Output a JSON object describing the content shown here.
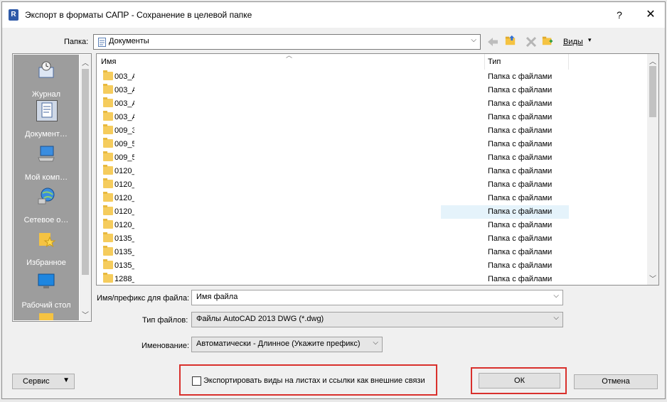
{
  "window": {
    "app_icon_letter": "R",
    "title": "Экспорт в форматы САПР - Сохранение в целевой папке",
    "help_label": "?",
    "close_label": "✕"
  },
  "toolbar": {
    "folder_label": "Папка:",
    "folder_value": "Документы",
    "views_label": "Виды",
    "back_icon": "back-arrow-icon",
    "up_icon": "folder-up-icon",
    "delete_icon": "delete-x-icon",
    "new_folder_icon": "new-folder-icon"
  },
  "places": [
    {
      "label": "Журнал",
      "icon": "history-icon"
    },
    {
      "label": "Документ…",
      "icon": "documents-icon"
    },
    {
      "label": "Мой комп…",
      "icon": "computer-icon"
    },
    {
      "label": "Сетевое о…",
      "icon": "network-icon"
    },
    {
      "label": "Избранное",
      "icon": "favorites-icon"
    },
    {
      "label": "Рабочий стол",
      "icon": "desktop-icon"
    }
  ],
  "file_list": {
    "columns": {
      "name": "Имя",
      "type": "Тип"
    },
    "rows": [
      {
        "name": "003_A",
        "type": "Папка с файлами"
      },
      {
        "name": "003_A",
        "type": "Папка с файлами"
      },
      {
        "name": "003_A",
        "type": "Папка с файлами"
      },
      {
        "name": "003_A",
        "type": "Папка с файлами"
      },
      {
        "name": "009_3",
        "type": "Папка с файлами"
      },
      {
        "name": "009_5",
        "type": "Папка с файлами"
      },
      {
        "name": "009_5",
        "type": "Папка с файлами"
      },
      {
        "name": "0120_",
        "type": "Папка с файлами"
      },
      {
        "name": "0120_",
        "type": "Папка с файлами"
      },
      {
        "name": "0120_",
        "type": "Папка с файлами"
      },
      {
        "name": "0120_",
        "type": "Папка с файлами"
      },
      {
        "name": "0120_",
        "type": "Папка с файлами"
      },
      {
        "name": "0135_",
        "type": "Папка с файлами"
      },
      {
        "name": "0135_",
        "type": "Папка с файлами"
      },
      {
        "name": "0135_",
        "type": "Папка с файлами"
      },
      {
        "name": "1288_",
        "type": "Папка с файлами"
      }
    ]
  },
  "form": {
    "filename_label": "Имя/префикс для файла:",
    "filename_value": "Имя файла",
    "filetype_label": "Тип файлов:",
    "filetype_value": "Файлы AutoCAD 2013 DWG  (*.dwg)",
    "naming_label": "Именование:",
    "naming_value": "Автоматически - Длинное (Укажите префикс)"
  },
  "bottom": {
    "service_label": "Сервис",
    "export_checkbox_label": "Экспортировать виды на листах и ссылки как внешние связи",
    "export_checkbox_checked": false,
    "ok_label": "ОК",
    "cancel_label": "Отмена"
  },
  "colors": {
    "highlight_red": "#d9302c",
    "accent_blue": "#2f5aa8",
    "folder_yellow": "#f5cc5d"
  }
}
